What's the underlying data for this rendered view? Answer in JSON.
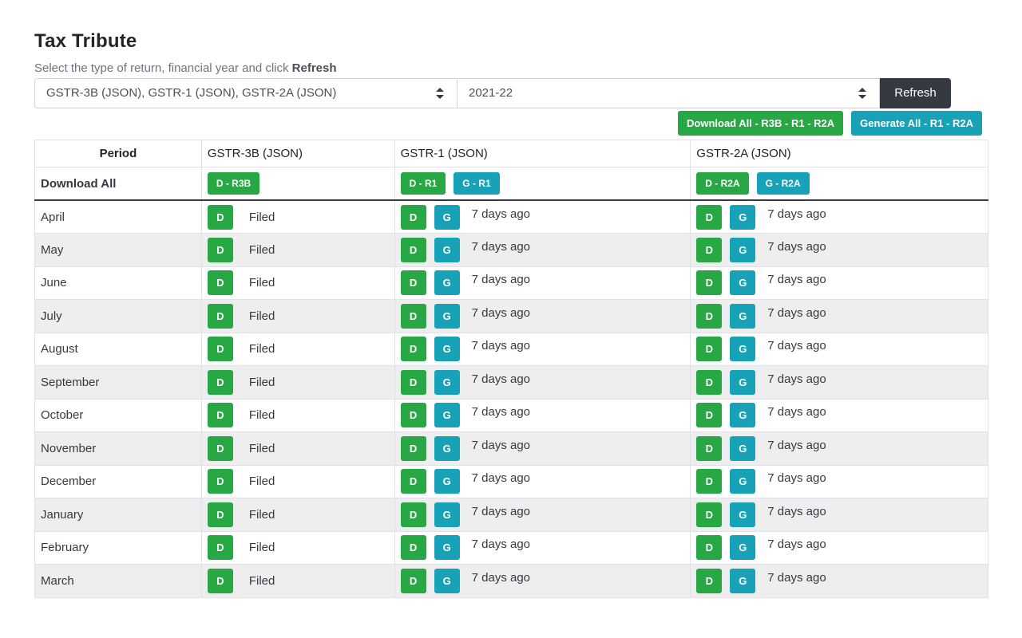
{
  "app": {
    "title": "Tax Tribute",
    "hint_prefix": "Select the type of return, financial year and click ",
    "hint_bold": "Refresh"
  },
  "controls": {
    "return_type": "GSTR-3B (JSON), GSTR-1 (JSON), GSTR-2A (JSON)",
    "financial_year": "2021-22",
    "refresh_label": "Refresh",
    "select_icon": "sort-arrows-icon"
  },
  "actions": {
    "download_all_label": "Download All - R3B - R1 - R2A",
    "generate_all_label": "Generate All - R1 - R2A"
  },
  "table": {
    "headers": [
      "Period",
      "GSTR-3B (JSON)",
      "GSTR-1 (JSON)",
      "GSTR-2A (JSON)"
    ],
    "download_all_label": "Download All",
    "bulk_buttons": {
      "d_r3b": "D - R3B",
      "d_r1": "D - R1",
      "g_r1": "G - R1",
      "d_r2a": "D - R2A",
      "g_r2a": "G - R2A"
    },
    "d_label": "D",
    "g_label": "G",
    "rows": [
      {
        "month": "April",
        "r3b_status": "Filed",
        "r1_status": "7 days ago",
        "r2a_status": "7 days ago"
      },
      {
        "month": "May",
        "r3b_status": "Filed",
        "r1_status": "7 days ago",
        "r2a_status": "7 days ago"
      },
      {
        "month": "June",
        "r3b_status": "Filed",
        "r1_status": "7 days ago",
        "r2a_status": "7 days ago"
      },
      {
        "month": "July",
        "r3b_status": "Filed",
        "r1_status": "7 days ago",
        "r2a_status": "7 days ago"
      },
      {
        "month": "August",
        "r3b_status": "Filed",
        "r1_status": "7 days ago",
        "r2a_status": "7 days ago"
      },
      {
        "month": "September",
        "r3b_status": "Filed",
        "r1_status": "7 days ago",
        "r2a_status": "7 days ago"
      },
      {
        "month": "October",
        "r3b_status": "Filed",
        "r1_status": "7 days ago",
        "r2a_status": "7 days ago"
      },
      {
        "month": "November",
        "r3b_status": "Filed",
        "r1_status": "7 days ago",
        "r2a_status": "7 days ago"
      },
      {
        "month": "December",
        "r3b_status": "Filed",
        "r1_status": "7 days ago",
        "r2a_status": "7 days ago"
      },
      {
        "month": "January",
        "r3b_status": "Filed",
        "r1_status": "7 days ago",
        "r2a_status": "7 days ago"
      },
      {
        "month": "February",
        "r3b_status": "Filed",
        "r1_status": "7 days ago",
        "r2a_status": "7 days ago"
      },
      {
        "month": "March",
        "r3b_status": "Filed",
        "r1_status": "7 days ago",
        "r2a_status": "7 days ago"
      }
    ]
  },
  "colors": {
    "download_green": "#28a745",
    "generate_teal": "#17a2b8",
    "refresh_dark": "#343a40"
  }
}
